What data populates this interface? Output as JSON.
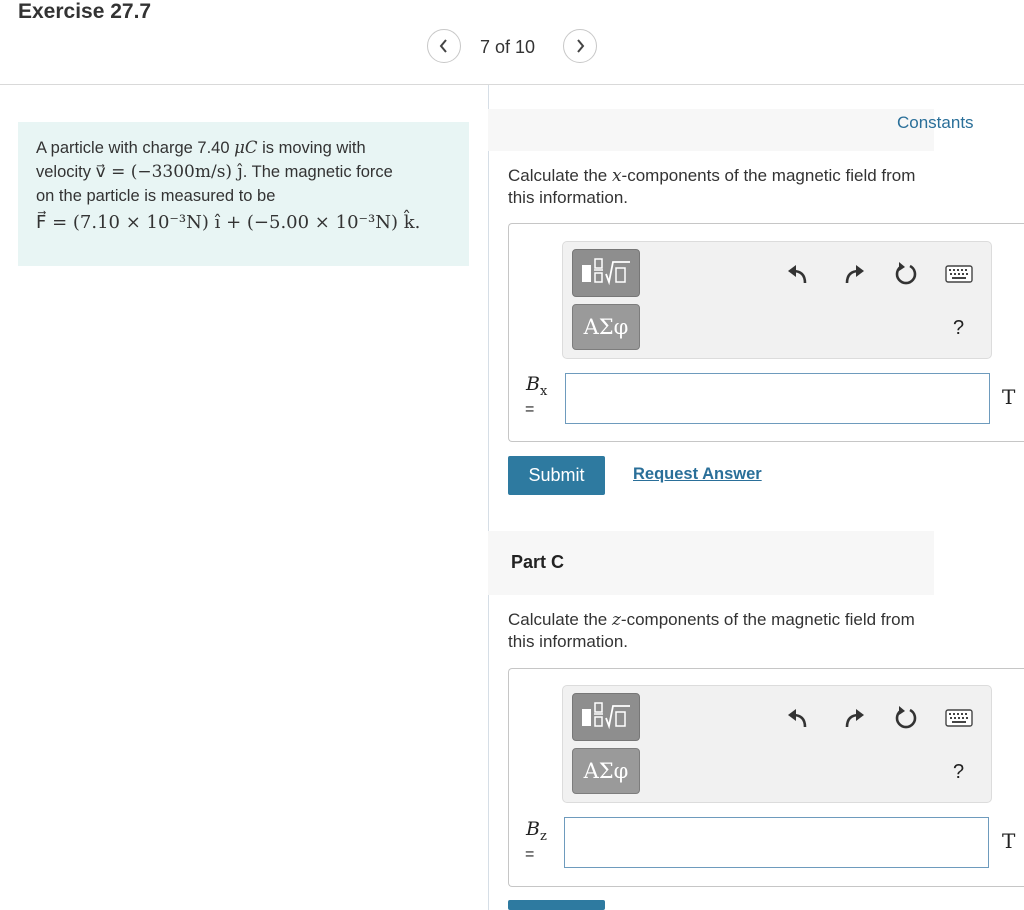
{
  "header": {
    "title": "Exercise 27.7",
    "pager": "7 of 10"
  },
  "problem": {
    "line1_pre": "A particle with charge 7.40 ",
    "line1_unit": "μC",
    "line1_post": " is moving with",
    "line2_pre": "velocity ",
    "line2_math": "v⃗ = (−3300m/s) ĵ",
    "line2_post": ". The magnetic force",
    "line3": "on the particle is measured to be",
    "line4_math": "F⃗ = (7.10 × 10⁻³N) î + (−5.00 × 10⁻³N) k̂."
  },
  "constants_link": "Constants",
  "part_b": {
    "question_pre": "Calculate the ",
    "question_var": "x",
    "question_post": "-components of the magnetic field from this information.",
    "var_main": "B",
    "var_sub": "x",
    "eq": "=",
    "input_value": "",
    "unit": "T",
    "submit_label": "Submit",
    "request_label": "Request Answer",
    "greek_label": "ΑΣφ",
    "help_label": "?"
  },
  "part_c": {
    "heading": "Part C",
    "question_pre": "Calculate the ",
    "question_var": "z",
    "question_post": "-components of the magnetic field from this information.",
    "var_main": "B",
    "var_sub": "z",
    "eq": "=",
    "input_value": "",
    "unit": "T",
    "greek_label": "ΑΣφ",
    "help_label": "?"
  },
  "icons": {
    "prev": "chevron-left-icon",
    "next": "chevron-right-icon",
    "undo": "undo-icon",
    "redo": "redo-icon",
    "reset": "reset-icon",
    "keyboard": "keyboard-icon",
    "template": "templates-icon"
  },
  "colors": {
    "accent": "#2e7aa0",
    "link": "#2a6f99",
    "problem_bg": "#e8f5f4"
  }
}
